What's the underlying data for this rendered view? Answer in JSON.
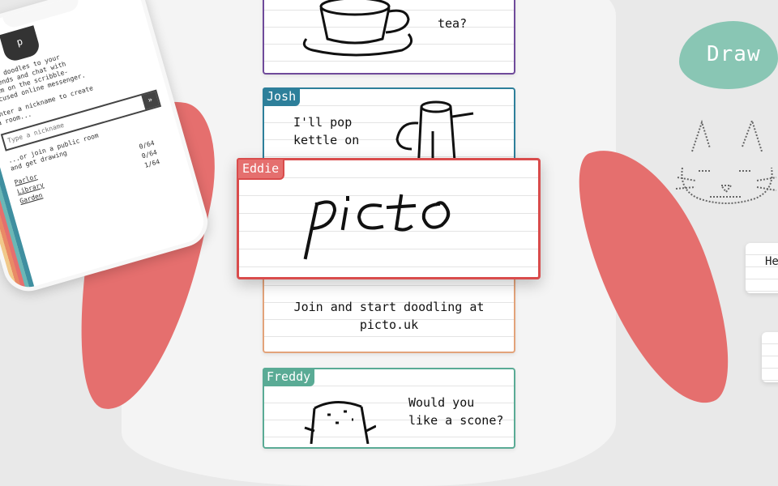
{
  "draw_label": "Draw",
  "phone": {
    "logo": "p",
    "intro_text": "Send doodles to your\nfriends and chat with\nthem on the scribble-\nfocused online messenger.",
    "nickname_prompt": "Enter a nickname to create\na room...",
    "nickname_placeholder": "Type a nickname",
    "go_icon": "arrow-icon",
    "public_text": "...or join a public room\nand get drawing",
    "rooms": [
      {
        "name": "Parlor",
        "count": "0/64"
      },
      {
        "name": "Library",
        "count": "0/64"
      },
      {
        "name": "Garden",
        "count": "1/64"
      }
    ]
  },
  "cards": {
    "tea": {
      "text": "tea?"
    },
    "josh": {
      "user": "Josh",
      "text": "I'll pop\nkettle on"
    },
    "eddie": {
      "user": "Eddie",
      "text": "picto"
    },
    "promo": {
      "text": "Join and start doodling at\npicto.uk"
    },
    "freddy": {
      "user": "Freddy",
      "text": "Would you\nlike a scone?"
    }
  },
  "side_note": {
    "text": "He"
  },
  "colors": {
    "purple": "#6f4a9a",
    "blue": "#2d7f9a",
    "red": "#d94c4c",
    "orange": "#e3a37a",
    "teal": "#5aab95",
    "coral": "#e56f6e",
    "mint": "#89c6b4"
  }
}
